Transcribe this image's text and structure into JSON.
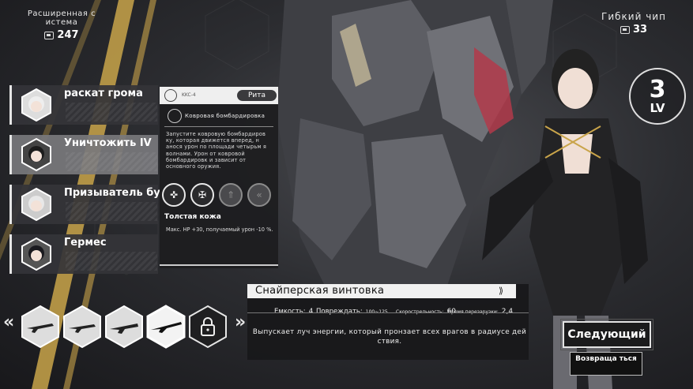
{
  "resources": {
    "left": {
      "title": "Расширенная с истема",
      "value": "247",
      "icon": "chip-icon"
    },
    "right": {
      "title": "Гибкий чип",
      "value": "33",
      "icon": "chip-icon"
    }
  },
  "level": {
    "number": "3",
    "label": "LV"
  },
  "skills": [
    {
      "name": "раскат грома"
    },
    {
      "name": "Уничтожить IV"
    },
    {
      "name": "Призыватель бу"
    },
    {
      "name": "Гермес"
    }
  ],
  "detail": {
    "code": "KKC-4",
    "badge": "Рита",
    "subtitle": "Ковровая бомбардировка",
    "description": "Запустите ковровую бомбардиров ку, которая движется вперед, н анося урон по площади четырьм я волнами. Урон от ковровой бомбардировк и зависит от основного оружия.",
    "perk_icons": [
      "crosshair-icon",
      "shield-cross-icon",
      "arrow-up-icon",
      "double-arrow-icon"
    ],
    "perk_title": "Толстая кожа",
    "perk_desc": "Макс. HP +30, получаемый урон -10 %."
  },
  "weapon_selector": {
    "left_arrow": "«",
    "right_arrow": "»",
    "slots": [
      "rifle-icon",
      "rifle-icon",
      "shotgun-icon",
      "sniper-icon",
      "lock-icon"
    ]
  },
  "weapon": {
    "name": "Снайперская винтовка",
    "capacity_label": "Емкость:",
    "capacity_value": "4",
    "damage_label": "Повреждать:",
    "damage_value": "100~125",
    "rate_label": "Скорострельность:",
    "rate_value": "60",
    "reload_label": "Время перезарузки:",
    "reload_value": "2,4",
    "description": "Выпускает луч энергии, который пронзает всех врагов в радиусе дей ствия."
  },
  "buttons": {
    "next": "Следующий",
    "back": "Возвраща ться"
  }
}
